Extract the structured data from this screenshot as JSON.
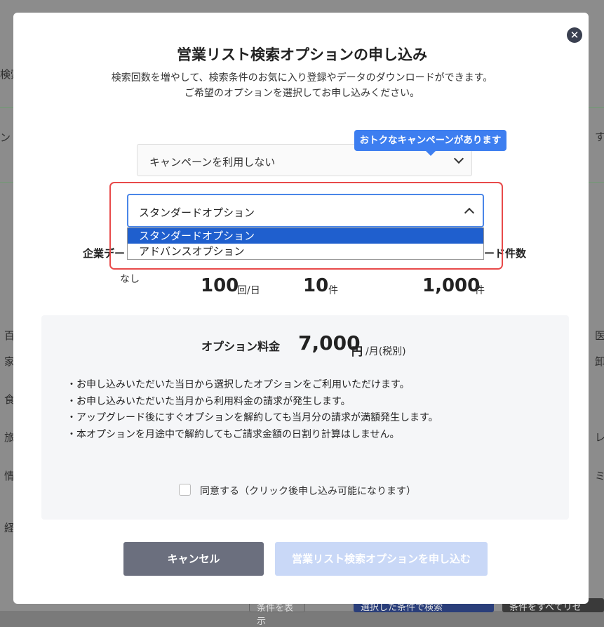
{
  "background": {
    "left_texts": [
      "検索",
      "ン",
      "百",
      "家",
      "食",
      "旅",
      "情",
      "経"
    ],
    "right_texts": [
      "す",
      "医",
      "卸",
      "レ",
      "ミ"
    ],
    "bottom_buttons": [
      "条件を表示",
      "選択した条件で検索",
      "条件をすべてリセ"
    ]
  },
  "modal": {
    "title": "営業リスト検索オプションの申し込み",
    "subtitle_lines": [
      "検索回数を増やして、検索条件のお気に入り登録やデータのダウンロードができます。",
      "ご希望のオプションを選択してお申し込みください。"
    ],
    "campaign": {
      "selected": "キャンペーンを利用しない",
      "tooltip": "おトクなキャンペーンがあります"
    },
    "option_select": {
      "selected": "スタンダードオプション",
      "options": [
        "スタンダードオプション",
        "アドバンスオプション"
      ]
    },
    "features": {
      "label_left": "企業デー",
      "label_right": "ード件数",
      "nashi": "なし",
      "values": [
        {
          "value": "100",
          "unit": "回/日"
        },
        {
          "value": "10",
          "unit": "件"
        },
        {
          "value": "1,000",
          "unit": "件"
        }
      ]
    },
    "fee": {
      "label": "オプション料金",
      "amount": "7,000",
      "currency": "円",
      "per": "/月(税別)"
    },
    "notes": [
      "・お申し込みいただいた当日から選択したオプションをご利用いただけます。",
      "・お申し込みいただいた当月から利用料金の請求が発生します。",
      "・アップグレード後にすぐオプションを解約しても当月分の請求が満額発生します。",
      "・本オプションを月途中で解約してもご請求金額の日割り計算はしません。"
    ],
    "agree_label": "同意する（クリック後申し込み可能になります）",
    "buttons": {
      "cancel": "キャンセル",
      "apply": "営業リスト検索オプションを申し込む"
    },
    "colors": {
      "primary": "#1f5fce",
      "tooltip": "#3d7ef0",
      "highlight": "#e84a4a",
      "cancel": "#6b6f7e",
      "apply_disabled": "#c9d8f7"
    }
  }
}
